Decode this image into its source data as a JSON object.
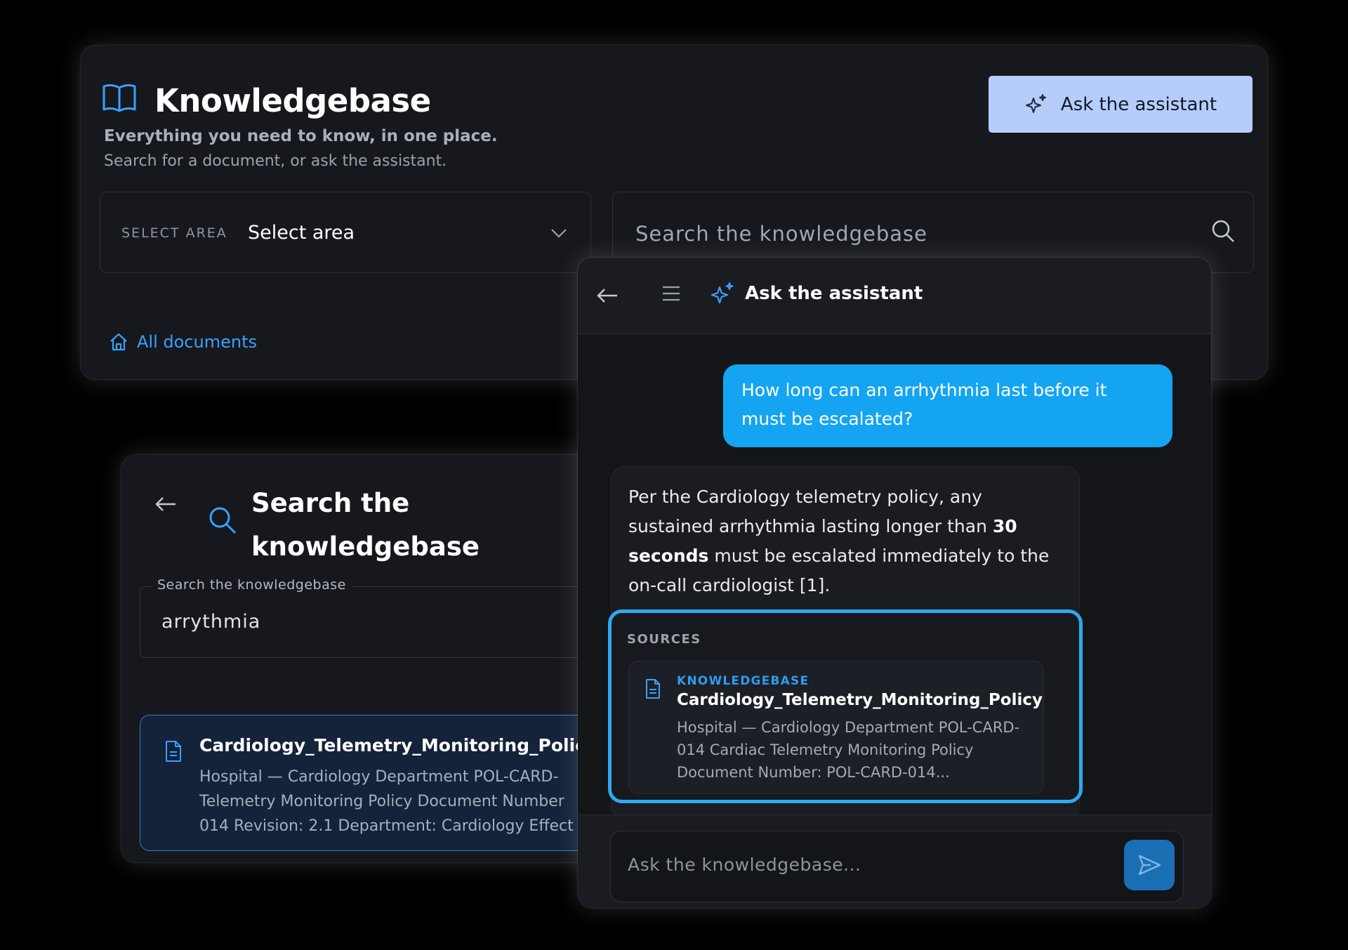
{
  "knowledgebase": {
    "title": "Knowledgebase",
    "subtitle": "Everything you need to know, in one place.",
    "description": "Search for a document, or ask the assistant.",
    "ask_button_label": "Ask the assistant",
    "area_label": "SELECT AREA",
    "area_value": "Select area",
    "search_placeholder": "Search the knowledgebase",
    "all_documents_link": "All documents"
  },
  "search_panel": {
    "title": "Search the knowledgebase",
    "field_label": "Search the knowledgebase",
    "field_value": "arrythmia",
    "result": {
      "title": "Cardiology_Telemetry_Monitoring_Policy",
      "body_lines": [
        "Hospital — Cardiology Department POL-CARD-",
        "Telemetry Monitoring Policy Document Number",
        "014 Revision: 2.1 Department: Cardiology Effect"
      ]
    }
  },
  "assistant": {
    "title": "Ask the assistant",
    "user_message": "How long can an arrhythmia last before it must be escalated?",
    "reply": {
      "before_bold": "Per the Cardiology telemetry policy, any sustained arrhythmia lasting longer than ",
      "bold": "30 seconds",
      "after_bold": " must be escalated immediately to the on-call cardiologist [1]."
    },
    "sources_label": "SOURCES",
    "source": {
      "tag": "KNOWLEDGEBASE",
      "title": "Cardiology_Telemetry_Monitoring_Policy",
      "snippet": "Hospital — Cardiology Department POL-CARD-014 Cardiac Telemetry Monitoring Policy Document Number: POL-CARD-014..."
    },
    "input_placeholder": "Ask the knowledgebase..."
  },
  "colors": {
    "accent": "#14a4f2",
    "link": "#3aa0ff",
    "ask_button_bg": "#b6cdfc",
    "panel_bg": "#16181d"
  },
  "icons": [
    "book-icon",
    "sparkle-icon",
    "chevron-down-icon",
    "search-icon",
    "home-icon",
    "back-arrow-icon",
    "menu-icon",
    "document-icon",
    "send-icon"
  ]
}
